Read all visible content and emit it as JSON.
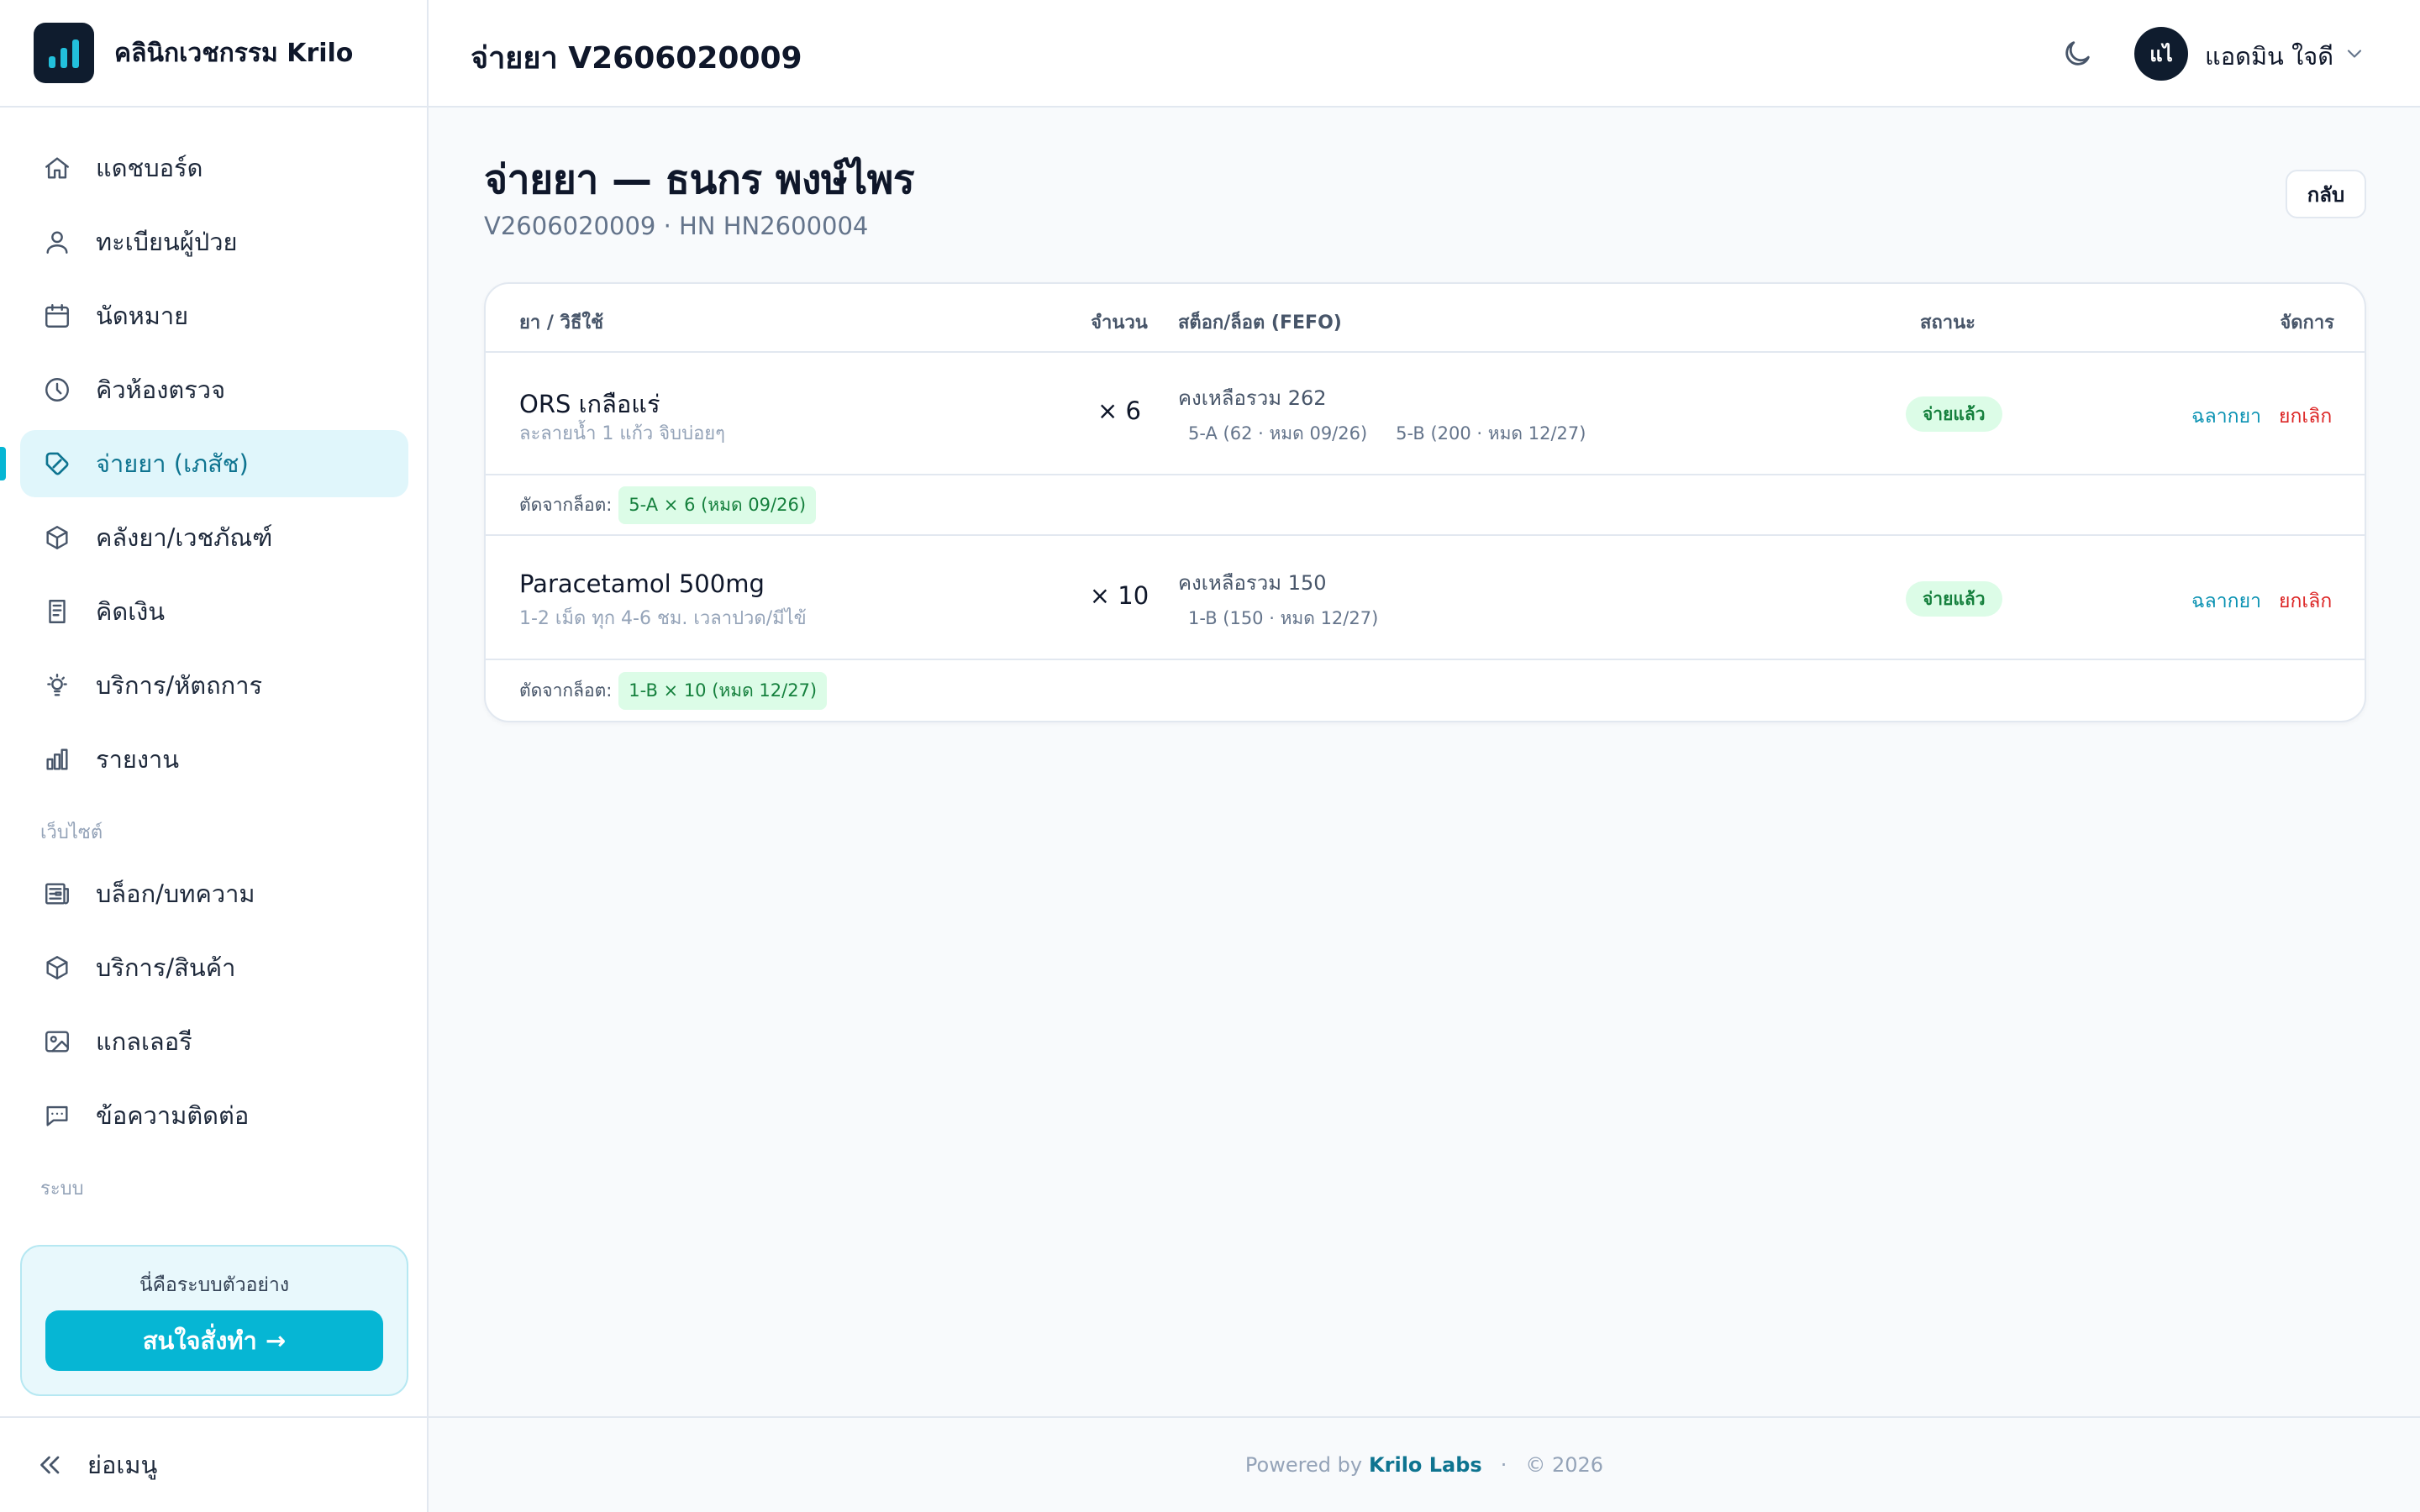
{
  "app": {
    "name": "คลินิกเวชกรรม Krilo"
  },
  "sidebar": {
    "items": [
      {
        "label": "แดชบอร์ด",
        "icon": "home-icon"
      },
      {
        "label": "ทะเบียนผู้ป่วย",
        "icon": "user-icon"
      },
      {
        "label": "นัดหมาย",
        "icon": "calendar-icon"
      },
      {
        "label": "คิวห้องตรวจ",
        "icon": "clock-icon"
      },
      {
        "label": "จ่ายยา (เภสัช)",
        "icon": "pill-tag-icon",
        "active": true
      },
      {
        "label": "คลังยา/เวชภัณฑ์",
        "icon": "box-icon"
      },
      {
        "label": "คิดเงิน",
        "icon": "receipt-icon"
      },
      {
        "label": "บริการ/หัตถการ",
        "icon": "lightbulb-icon"
      },
      {
        "label": "รายงาน",
        "icon": "bar-chart-icon"
      }
    ],
    "website_section_label": "เว็บไซต์",
    "website_items": [
      {
        "label": "บล็อก/บทความ",
        "icon": "newspaper-icon"
      },
      {
        "label": "บริการ/สินค้า",
        "icon": "box-icon"
      },
      {
        "label": "แกลเลอรี",
        "icon": "image-icon"
      },
      {
        "label": "ข้อความติดต่อ",
        "icon": "message-icon"
      }
    ],
    "system_section_label": "ระบบ",
    "promo": {
      "text": "นี่คือระบบตัวอย่าง",
      "button": "สนใจสั่งทำ →"
    },
    "collapse_label": "ย่อเมนู"
  },
  "header": {
    "title": "จ่ายยา V2606020009",
    "user": {
      "initials": "แไ",
      "name": "แอดมิน ใจดี"
    }
  },
  "page": {
    "title": "จ่ายยา — ธนกร พงษ์ไพร",
    "subtitle": "V2606020009 · HN HN2600004",
    "back_button": "กลับ"
  },
  "table": {
    "columns": {
      "drug": "ยา / วิธีใช้",
      "qty": "จำนวน",
      "stock": "สต็อก/ล็อต (FEFO)",
      "status": "สถานะ",
      "actions": "จัดการ"
    },
    "rows": [
      {
        "name": "ORS เกลือแร่",
        "usage": "ละลายน้ำ 1 แก้ว จิบบ่อยๆ",
        "qty": "× 6",
        "stock_total": "คงเหลือรวม 262",
        "lots": [
          "5-A (62 · หมด 09/26)",
          "5-B (200 · หมด 12/27)"
        ],
        "status": "จ่ายแล้ว",
        "action_label": "ฉลากยา",
        "action_cancel": "ยกเลิก",
        "deducted_label": "ตัดจากล็อต:",
        "deducted_lot": "5-A × 6 (หมด 09/26)"
      },
      {
        "name": "Paracetamol 500mg",
        "usage": "1-2 เม็ด ทุก 4-6 ชม. เวลาปวด/มีไข้",
        "qty": "× 10",
        "stock_total": "คงเหลือรวม 150",
        "lots": [
          "1-B (150 · หมด 12/27)"
        ],
        "status": "จ่ายแล้ว",
        "action_label": "ฉลากยา",
        "action_cancel": "ยกเลิก",
        "deducted_label": "ตัดจากล็อต:",
        "deducted_lot": "1-B × 10 (หมด 12/27)"
      }
    ]
  },
  "footer": {
    "powered_by": "Powered by",
    "brand": "Krilo Labs",
    "separator": "·",
    "copyright": "© 2026"
  },
  "colors": {
    "accent": "#06b6d4",
    "accent_dark": "#0e7490",
    "success": "#15803d",
    "danger": "#dc2626",
    "navy": "#0f1c2e"
  }
}
